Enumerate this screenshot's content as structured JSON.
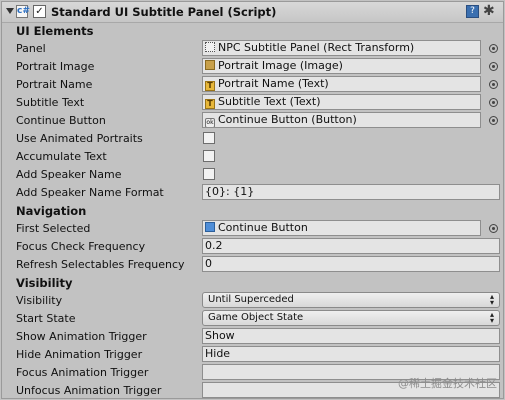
{
  "header": {
    "title": "Standard UI Subtitle Panel (Script)",
    "enabled_mark": "✓",
    "script_icon": "c#",
    "help_icon": "?",
    "gear_icon": "✱"
  },
  "sections": {
    "ui_elements": "UI Elements",
    "navigation": "Navigation",
    "visibility": "Visibility"
  },
  "fields": {
    "panel": {
      "label": "Panel",
      "value": "NPC Subtitle Panel (Rect Transform)"
    },
    "portrait_image": {
      "label": "Portrait Image",
      "value": "Portrait Image (Image)"
    },
    "portrait_name": {
      "label": "Portrait Name",
      "value": "Portrait Name (Text)"
    },
    "subtitle_text": {
      "label": "Subtitle Text",
      "value": "Subtitle Text (Text)"
    },
    "continue_button": {
      "label": "Continue Button",
      "value": "Continue Button (Button)"
    },
    "use_animated_portraits": {
      "label": "Use Animated Portraits",
      "checked": false
    },
    "accumulate_text": {
      "label": "Accumulate Text",
      "checked": false
    },
    "add_speaker_name": {
      "label": "Add Speaker Name",
      "checked": false
    },
    "add_speaker_name_format": {
      "label": "Add Speaker Name Format",
      "value": "{0}: {1}"
    },
    "first_selected": {
      "label": "First Selected",
      "value": "Continue Button"
    },
    "focus_check_frequency": {
      "label": "Focus Check Frequency",
      "value": "0.2"
    },
    "refresh_selectables_frequency": {
      "label": "Refresh Selectables Frequency",
      "value": "0"
    },
    "visibility": {
      "label": "Visibility",
      "value": "Until Superceded"
    },
    "start_state": {
      "label": "Start State",
      "value": "Game Object State"
    },
    "show_animation_trigger": {
      "label": "Show Animation Trigger",
      "value": "Show"
    },
    "hide_animation_trigger": {
      "label": "Hide Animation Trigger",
      "value": "Hide"
    },
    "focus_animation_trigger": {
      "label": "Focus Animation Trigger",
      "value": ""
    },
    "unfocus_animation_trigger": {
      "label": "Unfocus Animation Trigger",
      "value": ""
    }
  },
  "icons": {
    "text_component": "T",
    "button_component": "ok",
    "dropdown_arrow": "▴▾"
  },
  "watermark": "@稀土掘金技术社区"
}
